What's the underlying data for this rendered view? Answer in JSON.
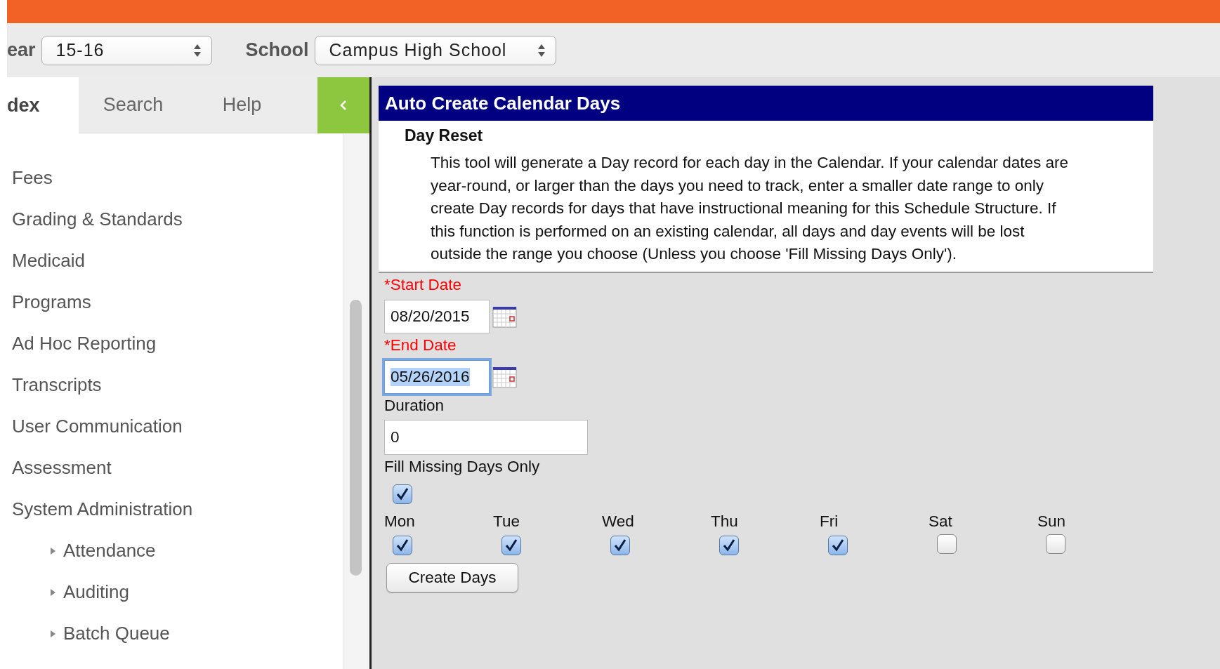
{
  "toolbar": {
    "year_label": "ear",
    "year_value": "15-16",
    "school_label": "School",
    "school_value": "Campus High School"
  },
  "sidebar": {
    "tabs": [
      {
        "label": "dex",
        "selected": true
      },
      {
        "label": "Search",
        "selected": false
      },
      {
        "label": "Help",
        "selected": false
      }
    ],
    "items": [
      {
        "label": "Fees"
      },
      {
        "label": "Grading & Standards"
      },
      {
        "label": "Medicaid"
      },
      {
        "label": "Programs"
      },
      {
        "label": "Ad Hoc Reporting"
      },
      {
        "label": "Transcripts"
      },
      {
        "label": "User Communication"
      },
      {
        "label": "Assessment"
      },
      {
        "label": "System Administration",
        "children": [
          {
            "label": "Attendance",
            "expanded": false
          },
          {
            "label": "Auditing",
            "expanded": false
          },
          {
            "label": "Batch Queue",
            "expanded": false
          }
        ]
      }
    ]
  },
  "panel": {
    "title": "Auto Create Calendar Days",
    "section": "Day Reset",
    "description": "This tool will generate a Day record for each day in the Calendar. If your calendar dates are year-round, or larger than the days you need to track, enter a smaller date range to only create Day records for days that have instructional meaning for this Schedule Structure. If this function is performed on an existing calendar, all days and day events will be lost outside the range you choose (Unless you choose 'Fill Missing Days Only').",
    "fields": [
      {
        "kind": "date",
        "label": "*Start Date",
        "required": true,
        "value": "08/20/2015",
        "focused": false
      },
      {
        "kind": "date",
        "label": "*End Date",
        "required": true,
        "value": "05/26/2016",
        "focused": true
      },
      {
        "kind": "text",
        "label": "Duration",
        "required": false,
        "value": "0",
        "focused": false
      },
      {
        "kind": "checkbox",
        "label": "Fill Missing Days Only",
        "checked": true
      }
    ],
    "days": [
      {
        "label": "Mon",
        "checked": true
      },
      {
        "label": "Tue",
        "checked": true
      },
      {
        "label": "Wed",
        "checked": true
      },
      {
        "label": "Thu",
        "checked": true
      },
      {
        "label": "Fri",
        "checked": true
      },
      {
        "label": "Sat",
        "checked": false
      },
      {
        "label": "Sun",
        "checked": false
      }
    ],
    "button": "Create Days"
  }
}
